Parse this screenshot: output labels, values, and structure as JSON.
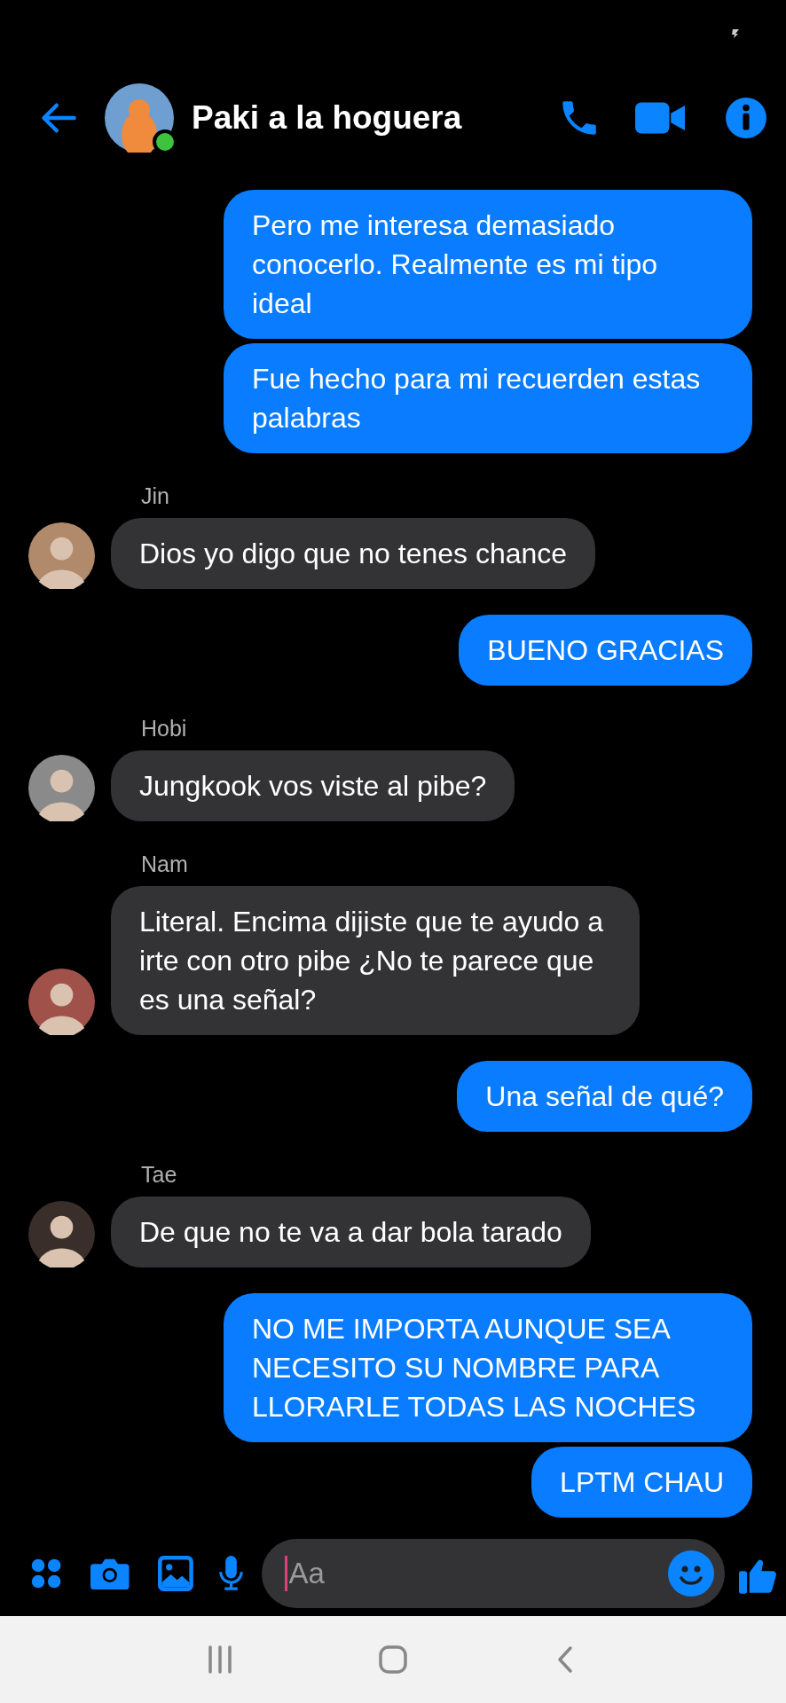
{
  "header": {
    "title": "Paki a la hoguera",
    "online": true
  },
  "messages": [
    {
      "kind": "sent",
      "text": "Pero me interesa demasiado conocerlo. Realmente es mi tipo ideal"
    },
    {
      "kind": "sent",
      "text": "Fue hecho para mi recuerden estas palabras"
    },
    {
      "kind": "received",
      "sender": "Jin",
      "text": "Dios yo digo que no tenes chance"
    },
    {
      "kind": "sent",
      "text": "BUENO GRACIAS"
    },
    {
      "kind": "received",
      "sender": "Hobi",
      "text": "Jungkook vos viste al pibe?"
    },
    {
      "kind": "received",
      "sender": "Nam",
      "text": "Literal. Encima dijiste que te ayudo a irte con otro pibe ¿No te parece que es una señal?"
    },
    {
      "kind": "sent",
      "text": "Una señal de qué?"
    },
    {
      "kind": "received",
      "sender": "Tae",
      "text": "De que no te va a dar bola tarado"
    },
    {
      "kind": "sent",
      "text": "NO ME IMPORTA AUNQUE SEA NECESITO SU NOMBRE PARA LLORARLE TODAS LAS NOCHES"
    },
    {
      "kind": "sent",
      "text": "LPTM CHAU"
    }
  ],
  "composer": {
    "placeholder": "Aa"
  }
}
